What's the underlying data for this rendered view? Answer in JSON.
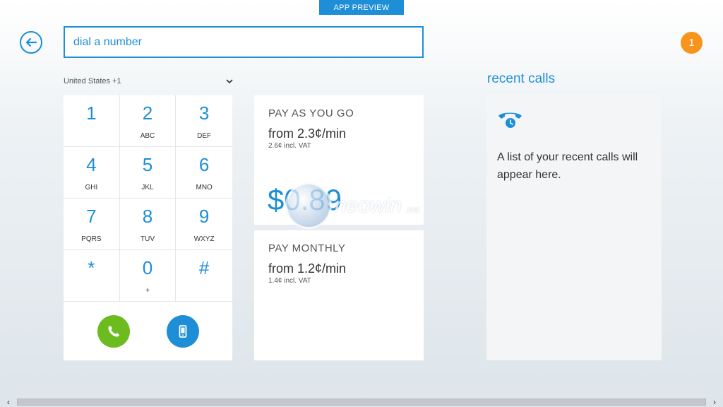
{
  "banner": {
    "label": "APP PREVIEW"
  },
  "dialer": {
    "placeholder": "dial a number",
    "value": "",
    "country": "United States +1",
    "keys": [
      {
        "digit": "1",
        "letters": ""
      },
      {
        "digit": "2",
        "letters": "ABC"
      },
      {
        "digit": "3",
        "letters": "DEF"
      },
      {
        "digit": "4",
        "letters": "GHI"
      },
      {
        "digit": "5",
        "letters": "JKL"
      },
      {
        "digit": "6",
        "letters": "MNO"
      },
      {
        "digit": "7",
        "letters": "PQRS"
      },
      {
        "digit": "8",
        "letters": "TUV"
      },
      {
        "digit": "9",
        "letters": "WXYZ"
      },
      {
        "digit": "*",
        "letters": ""
      },
      {
        "digit": "0",
        "letters": "+"
      },
      {
        "digit": "#",
        "letters": ""
      }
    ]
  },
  "notifications": {
    "count": "1"
  },
  "plans": {
    "payg": {
      "title": "PAY AS YOU GO",
      "rate": "from 2.3¢/min",
      "vat": "2.6¢ incl. VAT",
      "price": "$0.89"
    },
    "monthly": {
      "title": "PAY MONTHLY",
      "rate": "from 1.2¢/min",
      "vat": "1.4¢ incl. VAT"
    }
  },
  "recent": {
    "title": "recent calls",
    "empty_message": "A list of your recent calls will appear here."
  },
  "watermark": {
    "text": "neowin",
    "tld": ".net"
  },
  "colors": {
    "accent": "#1e8fd6",
    "call": "#6cbb1f",
    "badge": "#f7941d"
  },
  "icons": {
    "back": "back-arrow-icon",
    "call": "phone-icon",
    "sms": "mobile-icon",
    "recent": "phone-clock-icon",
    "dropdown": "chevron-down-icon"
  }
}
